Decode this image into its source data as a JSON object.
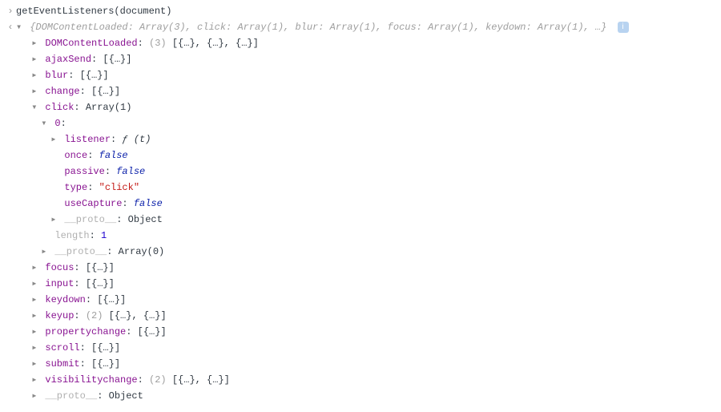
{
  "input": {
    "code": "getEventListeners(document)"
  },
  "result": {
    "summary_preview": "{DOMContentLoaded: Array(3), click: Array(1), blur: Array(1), focus: Array(1), keydown: Array(1), …}",
    "top": {
      "DOMContentLoaded": {
        "key": "DOMContentLoaded",
        "count": "(3)",
        "preview": "[{…}, {…}, {…}]"
      },
      "ajaxSend": {
        "key": "ajaxSend",
        "preview": "[{…}]"
      },
      "blur": {
        "key": "blur",
        "preview": "[{…}]"
      },
      "change": {
        "key": "change",
        "preview": "[{…}]"
      },
      "click": {
        "key": "click",
        "value_label": "Array(1)"
      },
      "focus": {
        "key": "focus",
        "preview": "[{…}]"
      },
      "input": {
        "key": "input",
        "preview": "[{…}]"
      },
      "keydown": {
        "key": "keydown",
        "preview": "[{…}]"
      },
      "keyup": {
        "key": "keyup",
        "count": "(2)",
        "preview": "[{…}, {…}]"
      },
      "propertychange": {
        "key": "propertychange",
        "preview": "[{…}]"
      },
      "scroll": {
        "key": "scroll",
        "preview": "[{…}]"
      },
      "submit": {
        "key": "submit",
        "preview": "[{…}]"
      },
      "visibilitychange": {
        "key": "visibilitychange",
        "count": "(2)",
        "preview": "[{…}, {…}]"
      },
      "proto": {
        "key": "__proto__",
        "value": "Object"
      }
    },
    "click_array": {
      "index0": {
        "label": "0",
        "listener": {
          "key": "listener",
          "func_sig": "ƒ (t)"
        },
        "once": {
          "key": "once",
          "value": "false"
        },
        "passive": {
          "key": "passive",
          "value": "false"
        },
        "type": {
          "key": "type",
          "value": "\"click\""
        },
        "useCapture": {
          "key": "useCapture",
          "value": "false"
        },
        "proto": {
          "key": "__proto__",
          "value": "Object"
        }
      },
      "length": {
        "key": "length",
        "value": "1"
      },
      "proto": {
        "key": "__proto__",
        "value": "Array(0)"
      }
    }
  }
}
